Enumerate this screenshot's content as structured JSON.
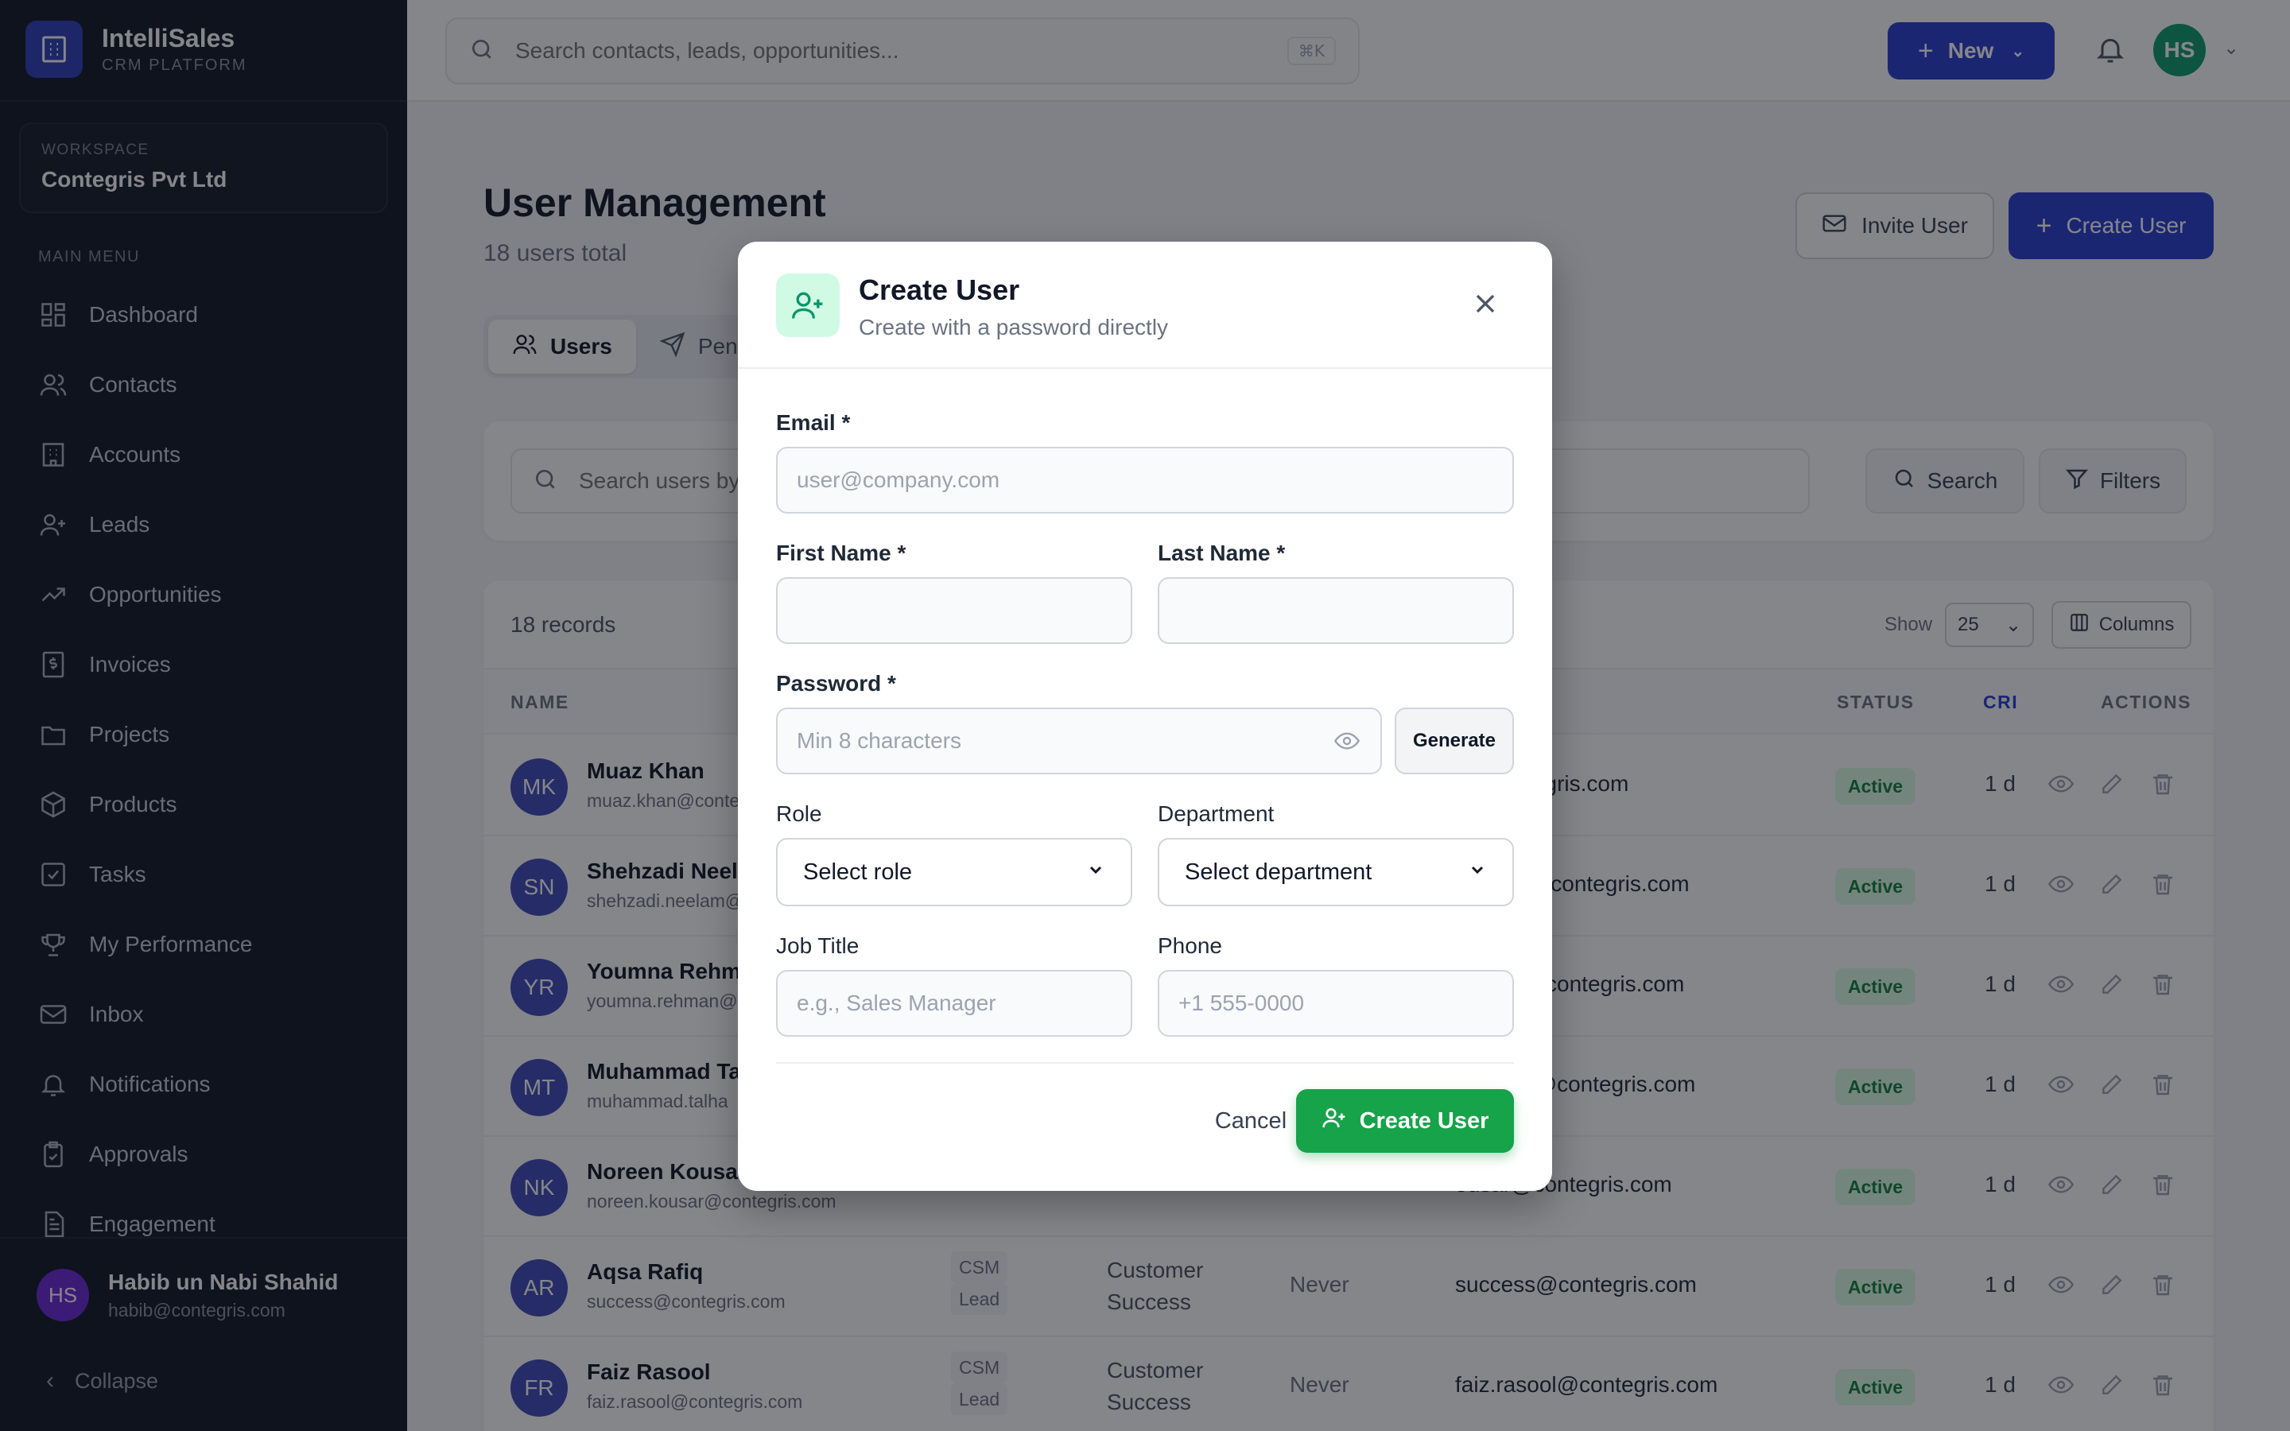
{
  "brand": {
    "name": "IntelliSales",
    "sub": "CRM PLATFORM"
  },
  "workspace": {
    "label": "WORKSPACE",
    "name": "Contegris Pvt Ltd"
  },
  "sidebar": {
    "menu_label": "MAIN MENU",
    "items": [
      {
        "label": "Dashboard",
        "icon": "grid-icon"
      },
      {
        "label": "Contacts",
        "icon": "users-icon"
      },
      {
        "label": "Accounts",
        "icon": "building-icon"
      },
      {
        "label": "Leads",
        "icon": "user-plus-icon"
      },
      {
        "label": "Opportunities",
        "icon": "trending-up-icon"
      },
      {
        "label": "Invoices",
        "icon": "dollar-file-icon"
      },
      {
        "label": "Projects",
        "icon": "folder-icon"
      },
      {
        "label": "Products",
        "icon": "box-icon"
      },
      {
        "label": "Tasks",
        "icon": "checkbox-icon"
      },
      {
        "label": "My Performance",
        "icon": "trophy-icon"
      },
      {
        "label": "Inbox",
        "icon": "mail-icon"
      },
      {
        "label": "Notifications",
        "icon": "bell-icon"
      },
      {
        "label": "Approvals",
        "icon": "clipboard-check-icon"
      },
      {
        "label": "Engagement",
        "icon": "document-icon"
      }
    ],
    "user": {
      "initials": "HS",
      "name": "Habib un Nabi Shahid",
      "email": "habib@contegris.com"
    },
    "collapse_label": "Collapse"
  },
  "topbar": {
    "search_placeholder": "Search contacts, leads, opportunities...",
    "shortcut": "⌘K",
    "new_label": "New",
    "avatar_initials": "HS"
  },
  "page": {
    "title": "User Management",
    "subtitle": "18 users total",
    "invite_label": "Invite User",
    "create_label": "Create User",
    "tabs": [
      {
        "label": "Users"
      },
      {
        "label": "Pen"
      }
    ],
    "search_placeholder": "Search users by n",
    "search_btn": "Search",
    "filters_btn": "Filters"
  },
  "table": {
    "records": "18 records",
    "show_label": "Show",
    "show_value": "25",
    "columns_label": "Columns",
    "headers": {
      "name": "NAME",
      "status": "STATUS",
      "cri": "CRI",
      "actions": "ACTIONS"
    },
    "rows": [
      {
        "initials": "MK",
        "name": "Muaz Khan",
        "email": "muaz.khan@conte",
        "role1": "",
        "role2": "",
        "dept1": "",
        "dept2": "",
        "login": "",
        "email2": "n@contegris.com",
        "status": "Active",
        "cri": "1 d"
      },
      {
        "initials": "SN",
        "name": "Shehzadi Neelu",
        "email": "shehzadi.neelam@",
        "role1": "",
        "role2": "",
        "dept1": "",
        "dept2": "",
        "login": "",
        "email2": "neelam@contegris.com",
        "status": "Active",
        "cri": "1 d"
      },
      {
        "initials": "YR",
        "name": "Youmna Rehma",
        "email": "youmna.rehman@",
        "role1": "",
        "role2": "",
        "dept1": "",
        "dept2": "",
        "login": "",
        "email2": "ehman@contegris.com",
        "status": "Active",
        "cri": "1 d"
      },
      {
        "initials": "MT",
        "name": "Muhammad Ta",
        "email": "muhammad.talha",
        "role1": "",
        "role2": "",
        "dept1": "",
        "dept2": "",
        "login": "",
        "email2": "ad.talha@contegris.com",
        "status": "Active",
        "cri": "1 d"
      },
      {
        "initials": "NK",
        "name": "Noreen Kousar",
        "email": "noreen.kousar@contegris.com",
        "role1": "",
        "role2": "",
        "dept1": "",
        "dept2": "",
        "login": "",
        "email2": "ousar@contegris.com",
        "status": "Active",
        "cri": "1 d"
      },
      {
        "initials": "AR",
        "name": "Aqsa Rafiq",
        "email": "success@contegris.com",
        "role1": "CSM",
        "role2": "Lead",
        "dept1": "Customer",
        "dept2": "Success",
        "login": "Never",
        "email2": "success@contegris.com",
        "status": "Active",
        "cri": "1 d"
      },
      {
        "initials": "FR",
        "name": "Faiz Rasool",
        "email": "faiz.rasool@contegris.com",
        "role1": "CSM",
        "role2": "Lead",
        "dept1": "Customer",
        "dept2": "Success",
        "login": "Never",
        "email2": "faiz.rasool@contegris.com",
        "status": "Active",
        "cri": "1 d"
      }
    ]
  },
  "modal": {
    "title": "Create User",
    "subtitle": "Create with a password directly",
    "email_label": "Email *",
    "email_placeholder": "user@company.com",
    "first_name_label": "First Name *",
    "last_name_label": "Last Name *",
    "password_label": "Password *",
    "password_placeholder": "Min 8 characters",
    "generate_label": "Generate",
    "role_label": "Role",
    "role_value": "Select role",
    "department_label": "Department",
    "department_value": "Select department",
    "job_title_label": "Job Title",
    "job_title_placeholder": "e.g., Sales Manager",
    "phone_label": "Phone",
    "phone_placeholder": "+1 555-0000",
    "cancel_label": "Cancel",
    "submit_label": "Create User"
  },
  "colors": {
    "sidebar_bg": "#111827",
    "primary": "#2b3fcf",
    "success": "#16a34a",
    "avatar_bg": "#3f4bb8"
  }
}
